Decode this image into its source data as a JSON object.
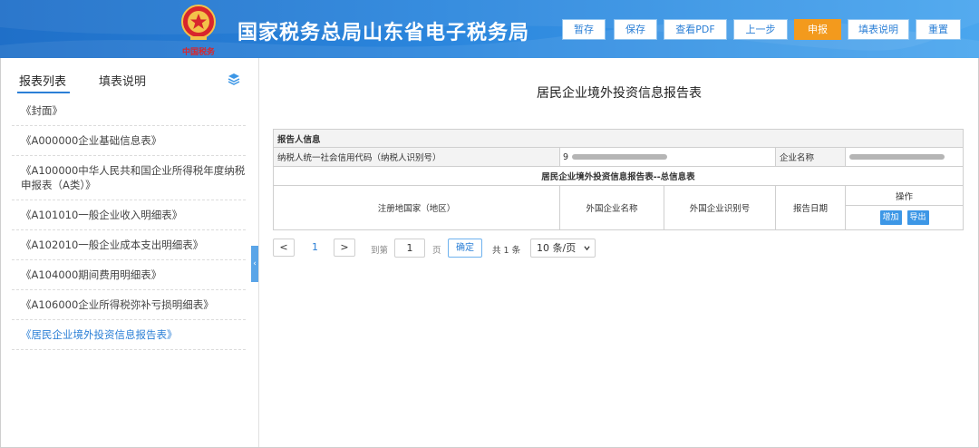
{
  "header": {
    "app_title": "国家税务总局山东省电子税务局",
    "brand_sub": "中国税务",
    "toolbar": [
      {
        "label": "暂存",
        "style": "default"
      },
      {
        "label": "保存",
        "style": "default"
      },
      {
        "label": "查看PDF",
        "style": "default"
      },
      {
        "label": "上一步",
        "style": "default"
      },
      {
        "label": "申报",
        "style": "primary"
      },
      {
        "label": "填表说明",
        "style": "default"
      },
      {
        "label": "重置",
        "style": "default"
      }
    ]
  },
  "sidebar": {
    "tabs": [
      {
        "label": "报表列表",
        "active": true
      },
      {
        "label": "填表说明",
        "active": false
      }
    ],
    "items": [
      {
        "label": "《封面》"
      },
      {
        "label": "《A000000企业基础信息表》"
      },
      {
        "label": "《A100000中华人民共和国企业所得税年度纳税申报表（A类）》"
      },
      {
        "label": "《A101010一般企业收入明细表》"
      },
      {
        "label": "《A102010一般企业成本支出明细表》"
      },
      {
        "label": "《A104000期间费用明细表》"
      },
      {
        "label": "《A106000企业所得税弥补亏损明细表》"
      },
      {
        "label": "《居民企业境外投资信息报告表》"
      }
    ],
    "active_index": 7,
    "collapse_glyph": "‹"
  },
  "main": {
    "report_title": "居民企业境外投资信息报告表",
    "reporter_section": "报告人信息",
    "taxpayer_id_label": "纳税人统一社会信用代码（纳税人识别号）",
    "taxpayer_id_value": "9",
    "company_name_label": "企业名称",
    "company_name_value": "",
    "summary_title": "居民企业境外投资信息报告表--总信息表",
    "columns": {
      "country": "注册地国家（地区）",
      "foreign_name": "外国企业名称",
      "foreign_id": "外国企业识别号",
      "report_date": "报告日期",
      "actions": "操作"
    },
    "add_label": "增加",
    "export_label": "导出"
  },
  "pager": {
    "prev_glyph": "<",
    "next_glyph": ">",
    "current_page": "1",
    "goto_label": "到第",
    "goto_value": "1",
    "page_unit": "页",
    "confirm_label": "确定",
    "total_text": "共 1 条",
    "page_size": "10 条/页"
  },
  "colors": {
    "header_start": "#1f6fc8",
    "header_end": "#4aa6ee",
    "accent": "#2b7fd6",
    "primary_button": "#f39a1d",
    "action_button": "#3d97e6"
  }
}
